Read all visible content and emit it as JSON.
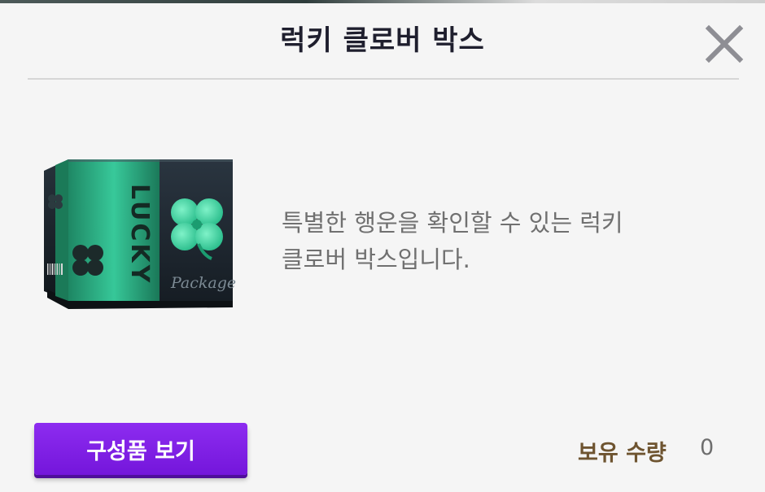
{
  "dialog": {
    "title": "럭키 클로버 박스",
    "close_icon": "close-icon"
  },
  "item": {
    "image_icon": "lucky-clover-box-icon",
    "box_side_text": "LUCKY",
    "box_front_text": "Package",
    "description": "특별한 행운을 확인할 수 있는 럭키\n클로버 박스입니다."
  },
  "footer": {
    "components_button_label": "구성품 보기",
    "owned_label": "보유 수량",
    "owned_value": "0"
  },
  "colors": {
    "button_purple": "#7f1fe6",
    "title_text": "#1f1f2e",
    "owned_label_brown": "#6e5430",
    "clover_green": "#2fd39a"
  }
}
